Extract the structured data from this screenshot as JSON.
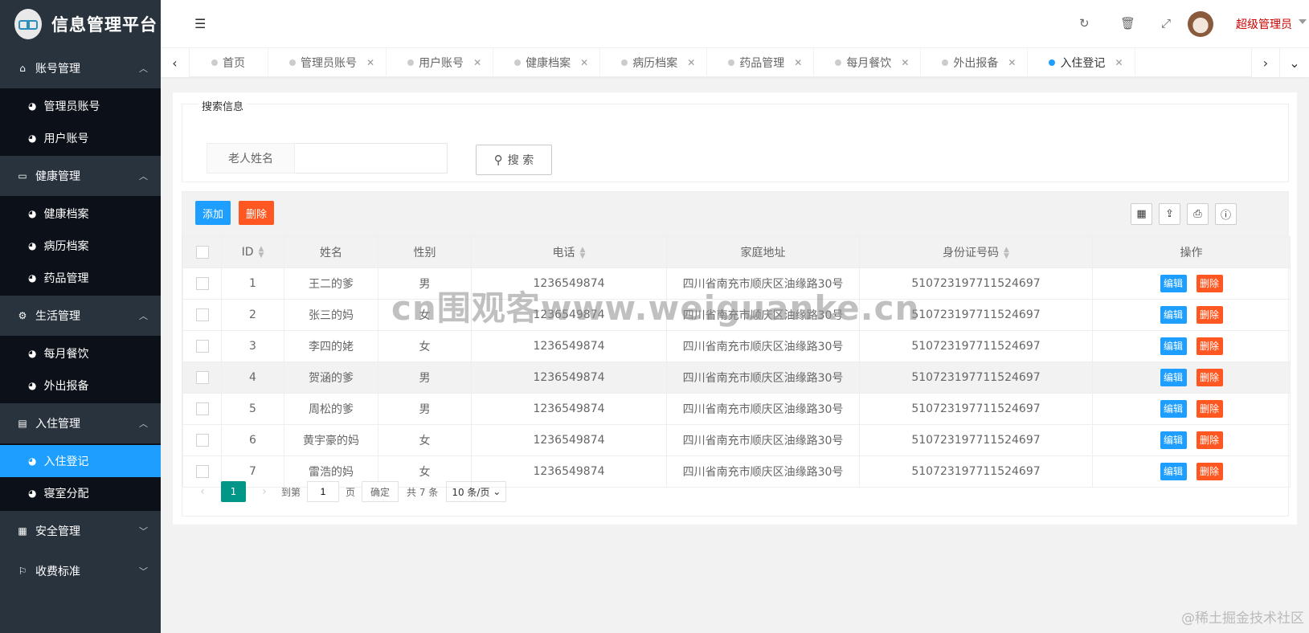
{
  "app": {
    "title": "信息管理平台"
  },
  "sidebar": {
    "groups": [
      {
        "label": "账号管理",
        "icon": "home-icon",
        "items": [
          {
            "label": "管理员账号"
          },
          {
            "label": "用户账号"
          }
        ]
      },
      {
        "label": "健康管理",
        "icon": "window-icon",
        "items": [
          {
            "label": "健康档案"
          },
          {
            "label": "病历档案"
          },
          {
            "label": "药品管理"
          }
        ]
      },
      {
        "label": "生活管理",
        "icon": "gears-icon",
        "items": [
          {
            "label": "每月餐饮"
          },
          {
            "label": "外出报备"
          }
        ]
      },
      {
        "label": "入住管理",
        "icon": "document-icon",
        "items": [
          {
            "label": "入住登记"
          },
          {
            "label": "寝室分配"
          }
        ]
      },
      {
        "label": "安全管理",
        "icon": "calendar-icon",
        "items": []
      },
      {
        "label": "收费标准",
        "icon": "flag-icon",
        "items": []
      }
    ],
    "active_item": "入住登记"
  },
  "header": {
    "user": "超级管理员"
  },
  "tabs": [
    {
      "label": "首页",
      "closable": false
    },
    {
      "label": "管理员账号",
      "closable": true
    },
    {
      "label": "用户账号",
      "closable": true
    },
    {
      "label": "健康档案",
      "closable": true
    },
    {
      "label": "病历档案",
      "closable": true
    },
    {
      "label": "药品管理",
      "closable": true
    },
    {
      "label": "每月餐饮",
      "closable": true
    },
    {
      "label": "外出报备",
      "closable": true
    },
    {
      "label": "入住登记",
      "closable": true,
      "active": true
    }
  ],
  "search": {
    "legend": "搜索信息",
    "field_label": "老人姓名",
    "input_value": "",
    "button_label": "搜 索"
  },
  "toolbar": {
    "add_label": "添加",
    "delete_label": "删除"
  },
  "table": {
    "headers": [
      "ID",
      "姓名",
      "性别",
      "电话",
      "家庭地址",
      "身份证号码",
      "操作"
    ],
    "rows": [
      {
        "id": "1",
        "name": "王二的爹",
        "gender": "男",
        "phone": "1236549874",
        "address": "四川省南充市顺庆区油缘路30号",
        "idcard": "510723197711524697"
      },
      {
        "id": "2",
        "name": "张三的妈",
        "gender": "女",
        "phone": "1236549874",
        "address": "四川省南充市顺庆区油缘路30号",
        "idcard": "510723197711524697"
      },
      {
        "id": "3",
        "name": "李四的姥",
        "gender": "女",
        "phone": "1236549874",
        "address": "四川省南充市顺庆区油缘路30号",
        "idcard": "510723197711524697"
      },
      {
        "id": "4",
        "name": "贺涵的爹",
        "gender": "男",
        "phone": "1236549874",
        "address": "四川省南充市顺庆区油缘路30号",
        "idcard": "510723197711524697"
      },
      {
        "id": "5",
        "name": "周松的爹",
        "gender": "男",
        "phone": "1236549874",
        "address": "四川省南充市顺庆区油缘路30号",
        "idcard": "510723197711524697"
      },
      {
        "id": "6",
        "name": "黄宇豪的妈",
        "gender": "女",
        "phone": "1236549874",
        "address": "四川省南充市顺庆区油缘路30号",
        "idcard": "510723197711524697"
      },
      {
        "id": "7",
        "name": "雷浩的妈",
        "gender": "女",
        "phone": "1236549874",
        "address": "四川省南充市顺庆区油缘路30号",
        "idcard": "510723197711524697"
      }
    ],
    "edit_label": "编辑",
    "delete_label": "删除"
  },
  "pager": {
    "current": "1",
    "goto_prefix": "到第",
    "goto_value": "1",
    "goto_suffix": "页",
    "confirm": "确定",
    "total": "共 7 条",
    "page_size": "10 条/页"
  },
  "watermark": "cn围观客www.weiguanke.cn",
  "footer_mark": "@稀土掘金技术社区",
  "colors": {
    "primary": "#1e9fff",
    "danger": "#ff5722",
    "pager": "#009688",
    "sidebar": "#28333e",
    "user": "#cc0000"
  }
}
